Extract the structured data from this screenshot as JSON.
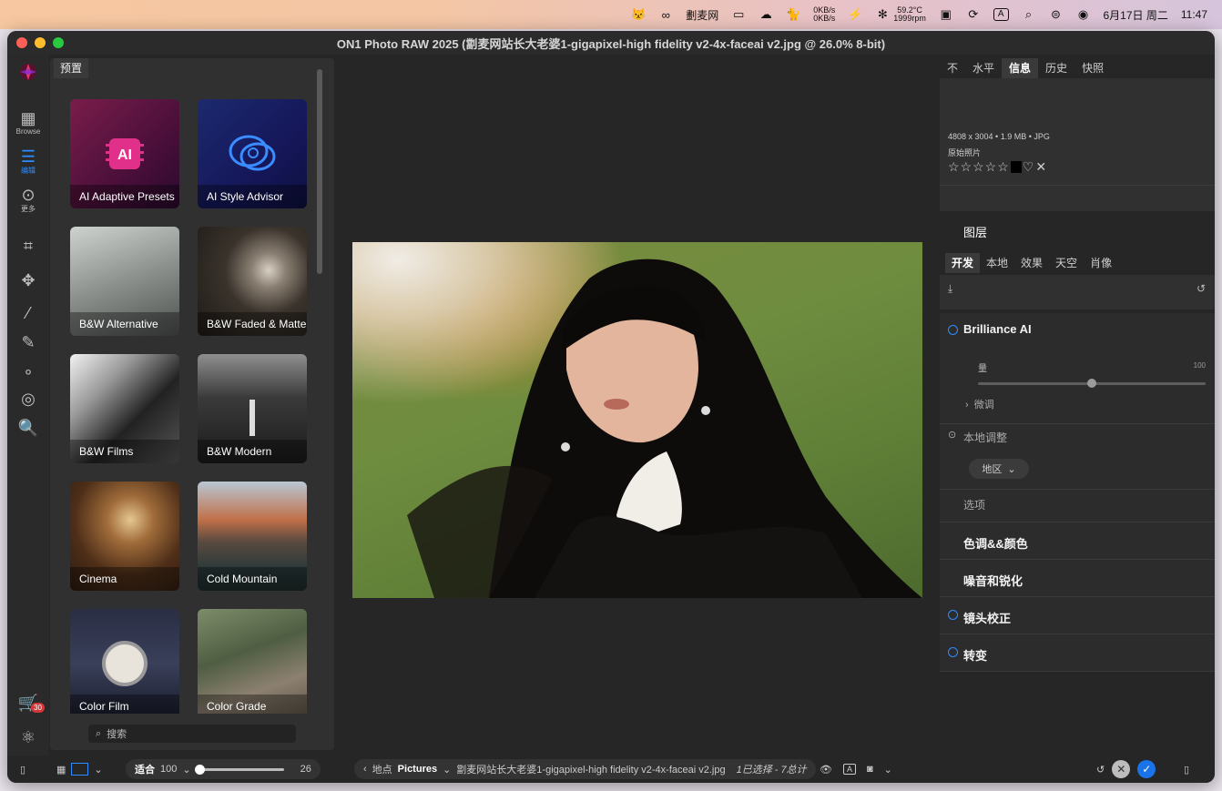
{
  "menubar": {
    "app_label": "劃麦网",
    "net_up": "0KB/s",
    "net_down": "0KB/s",
    "temp": "59.2°C",
    "fan": "1999rpm",
    "input_box": "A",
    "date": "6月17日 周二",
    "time": "11:47"
  },
  "window": {
    "title": "ON1 Photo RAW 2025 (劏麦网站长大老婆1-gigapixel-high fidelity v2-4x-faceai v2.jpg @ 26.0% 8-bit)"
  },
  "toolstrip": {
    "browse_label": "Browse",
    "edit_label": "编辑",
    "more_label": "更多",
    "cart_badge": "30"
  },
  "presets": {
    "tab_label": "预置",
    "search_placeholder": "搜索",
    "items": [
      {
        "label": "AI Adaptive Presets"
      },
      {
        "label": "AI Style Advisor"
      },
      {
        "label": "B&W Alternative"
      },
      {
        "label": "B&W Faded & Matte"
      },
      {
        "label": "B&W Films"
      },
      {
        "label": "B&W Modern"
      },
      {
        "label": "Cinema"
      },
      {
        "label": "Cold Mountain"
      },
      {
        "label": "Color Film"
      },
      {
        "label": "Color Grade"
      }
    ]
  },
  "right_panel": {
    "tabs": [
      "不",
      "水平",
      "信息",
      "历史",
      "快照"
    ],
    "active_tab": "信息",
    "info": {
      "dimensions": "4808 x 3004 • 1.9 MB • JPG",
      "original": "原始照片",
      "stars": "☆☆☆☆☆"
    },
    "layers_title": "图层",
    "dev_tabs": [
      "开发",
      "本地",
      "效果",
      "天空",
      "肖像"
    ],
    "active_dev_tab": "开发",
    "brilliance": {
      "title": "Brilliance AI",
      "amount_label": "量",
      "amount_max": "100",
      "amount_value": 0.5,
      "fine_tune": "微调",
      "local_adjust": "本地调整",
      "region_dropdown": "地区",
      "options": "选项"
    },
    "sections": [
      "色调&&颜色",
      "噪音和锐化",
      "镜头校正",
      "转变"
    ]
  },
  "bottombar": {
    "fit_label": "适合",
    "zoom_value": "100",
    "zoom_slider": "26",
    "location_label": "地点",
    "folder": "Pictures",
    "filename": "劏麦网站长大老婆1-gigapixel-high fidelity v2-4x-faceai v2.jpg",
    "selection": "1已选择 - 7总计"
  }
}
